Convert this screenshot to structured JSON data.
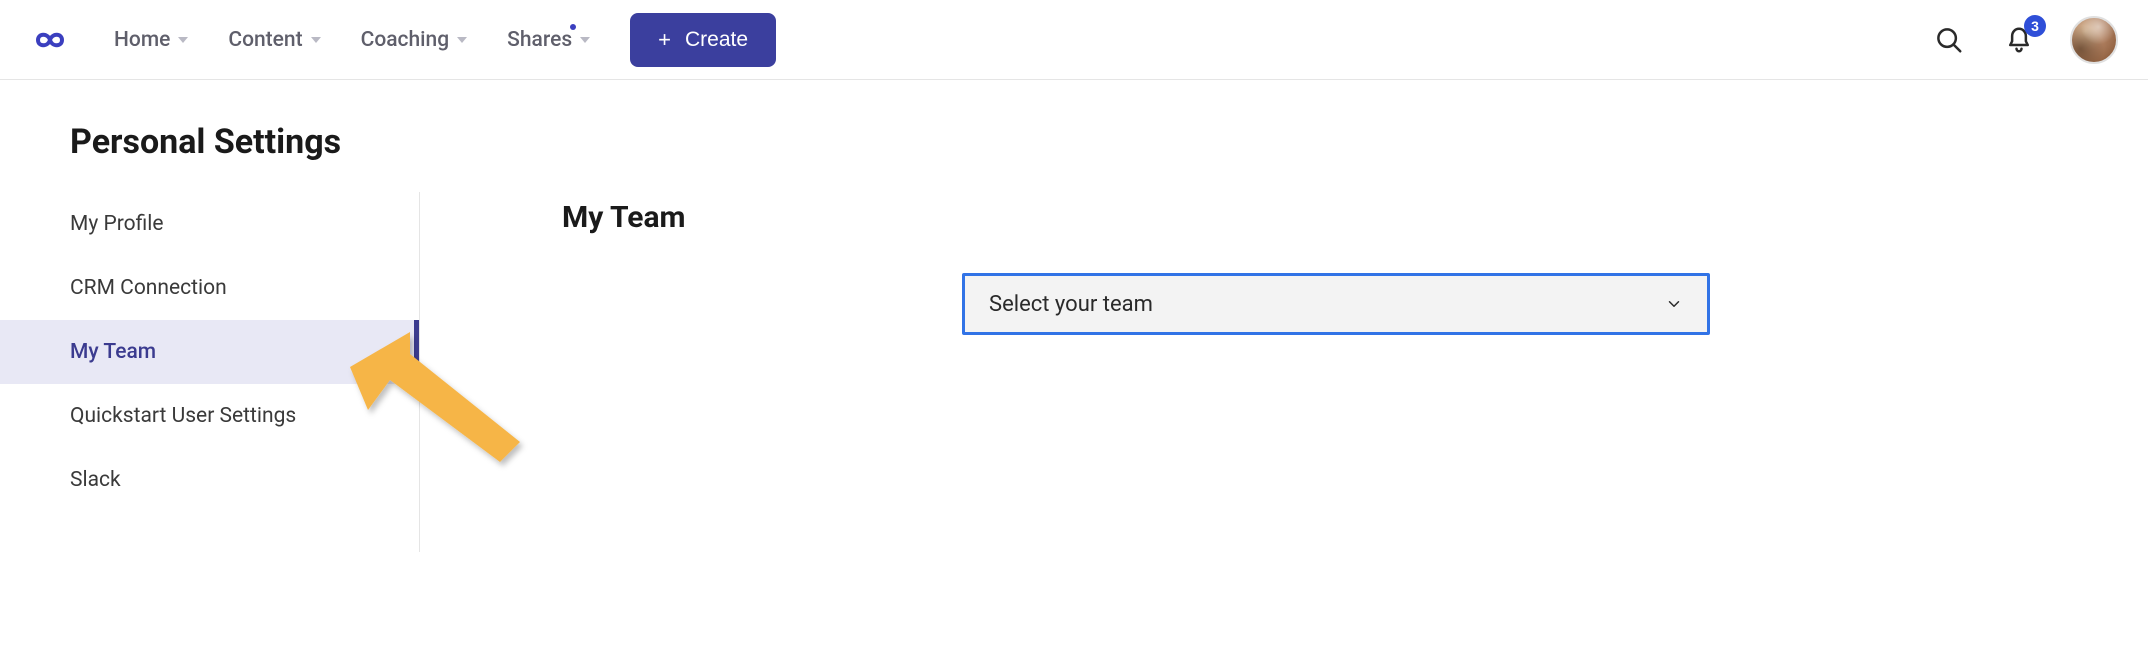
{
  "nav": {
    "home": "Home",
    "content": "Content",
    "coaching": "Coaching",
    "shares": "Shares",
    "create": "Create"
  },
  "notifications": {
    "count": "3"
  },
  "page": {
    "title": "Personal Settings",
    "section_title": "My Team"
  },
  "sidebar": {
    "items": [
      {
        "label": "My Profile"
      },
      {
        "label": "CRM Connection"
      },
      {
        "label": "My Team"
      },
      {
        "label": "Quickstart User Settings"
      },
      {
        "label": "Slack"
      }
    ]
  },
  "team_select": {
    "placeholder": "Select your team"
  }
}
